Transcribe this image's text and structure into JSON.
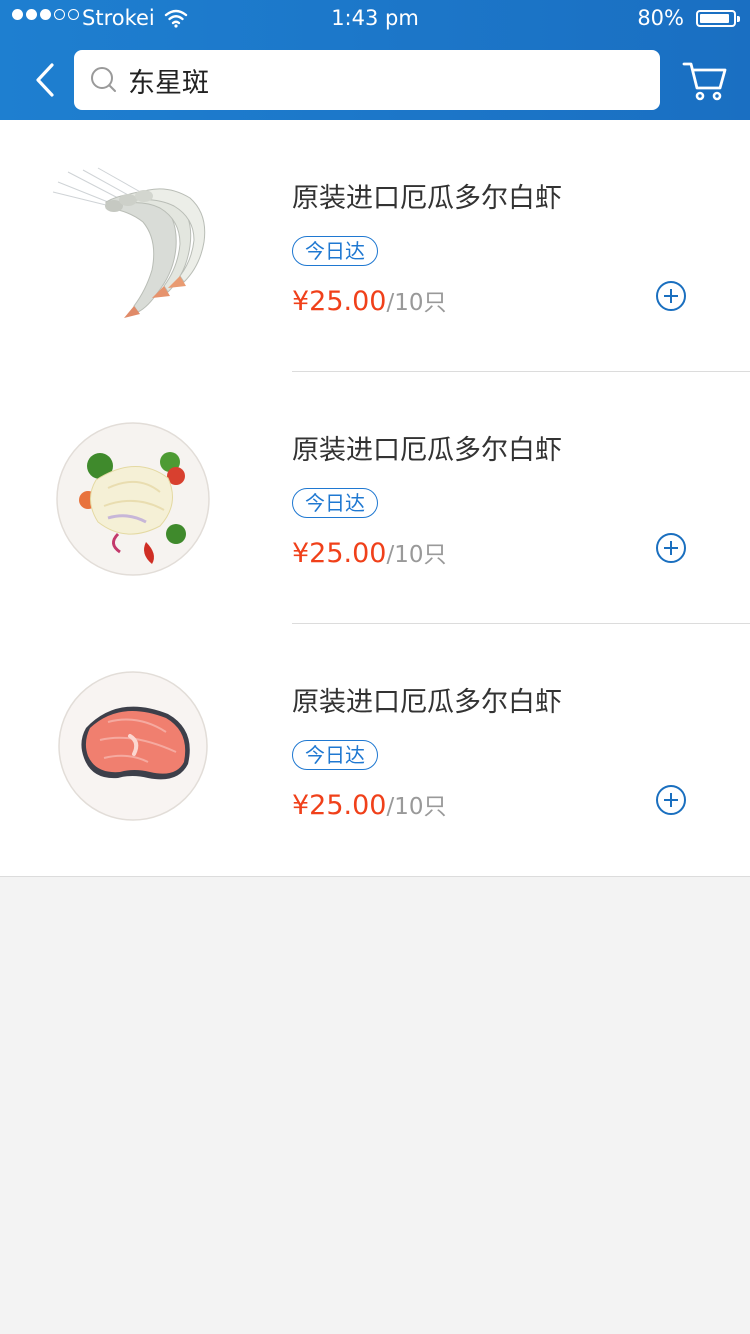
{
  "status_bar": {
    "carrier": "Strokei",
    "time": "1:43 pm",
    "battery_percent": "80%",
    "battery_level": 0.8,
    "signal_bars_filled": 3,
    "signal_bars_total": 5
  },
  "search": {
    "value": "东星斑",
    "placeholder": ""
  },
  "icons": {
    "back": "chevron-left-icon",
    "search": "search-icon",
    "cart": "cart-icon",
    "add": "plus-circle-icon"
  },
  "colors": {
    "header": "#1e7fd0",
    "accent": "#1f78d1",
    "price": "#f0401a"
  },
  "products": [
    {
      "title": "原装进口厄瓜多尔白虾",
      "tag": "今日达",
      "price": "¥25.00",
      "unit": "/10只",
      "image": "shrimp"
    },
    {
      "title": "原装进口厄瓜多尔白虾",
      "tag": "今日达",
      "price": "¥25.00",
      "unit": "/10只",
      "image": "fish-fillet-plate"
    },
    {
      "title": "原装进口厄瓜多尔白虾",
      "tag": "今日达",
      "price": "¥25.00",
      "unit": "/10只",
      "image": "salmon-steak-plate"
    }
  ]
}
